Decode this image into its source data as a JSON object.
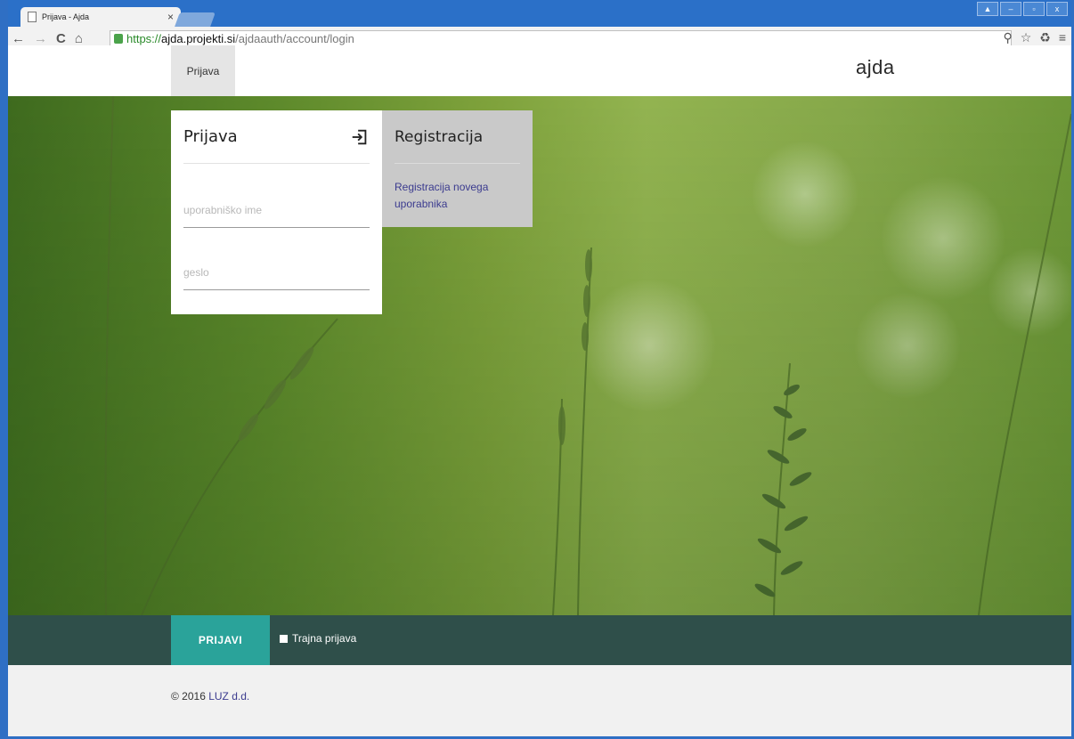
{
  "browser": {
    "tab_title": "Prijava - Ajda",
    "tab_close": "×",
    "url_scheme": "https://",
    "url_host": "ajda.projekti.si",
    "url_path": "/ajdaauth/account/login",
    "back_glyph": "←",
    "forward_glyph": "→",
    "reload_glyph": "C",
    "home_glyph": "⌂",
    "window_controls": [
      "▲",
      "–",
      "▫",
      "x"
    ],
    "toolbar_icons": [
      "⚲",
      "☆",
      "♻",
      "≡"
    ]
  },
  "header": {
    "nav_login": "Prijava",
    "brand": "ajda"
  },
  "login": {
    "title": "Prijava",
    "username_placeholder": "uporabniško ime",
    "password_placeholder": "geslo"
  },
  "register": {
    "title": "Registracija",
    "link": "Registracija novega uporabnika"
  },
  "actions": {
    "submit": "PRIJAVI",
    "remember": "Trajna prijava"
  },
  "footer": {
    "copyright": "© 2016",
    "company": "LUZ d.d."
  },
  "colors": {
    "accent": "#2aa39a",
    "action_bar": "#2f4f4a",
    "register_panel": "#c9c9c9",
    "link": "#3b3b8f",
    "titlebar": "#2b70c8"
  }
}
